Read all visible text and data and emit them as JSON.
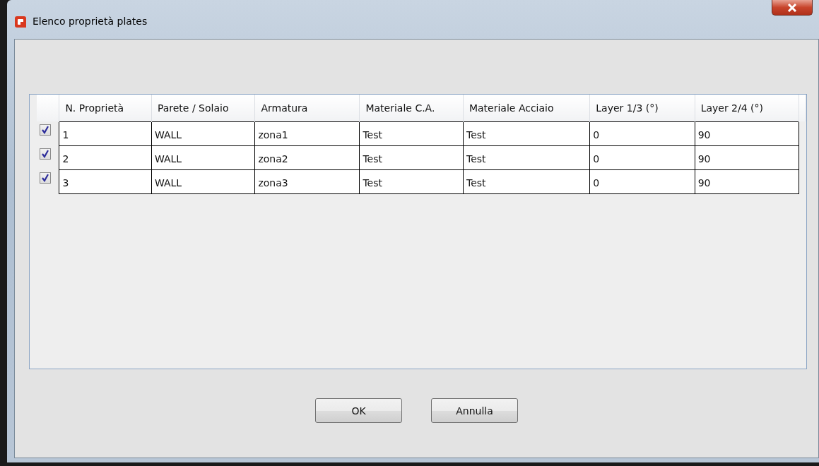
{
  "window": {
    "title": "Elenco proprietà plates"
  },
  "table": {
    "columns": [
      "N. Proprietà",
      "Parete / Solaio",
      "Armatura",
      "Materiale C.A.",
      "Materiale Acciaio",
      "Layer 1/3 (°)",
      "Layer 2/4 (°)"
    ],
    "rows": [
      {
        "checked": true,
        "cells": [
          "1",
          "WALL",
          "zona1",
          "Test",
          "Test",
          "0",
          "90"
        ]
      },
      {
        "checked": true,
        "cells": [
          "2",
          "WALL",
          "zona2",
          "Test",
          "Test",
          "0",
          "90"
        ]
      },
      {
        "checked": true,
        "cells": [
          "3",
          "WALL",
          "zona3",
          "Test",
          "Test",
          "0",
          "90"
        ]
      }
    ]
  },
  "buttons": [
    "OK",
    "Annulla"
  ]
}
